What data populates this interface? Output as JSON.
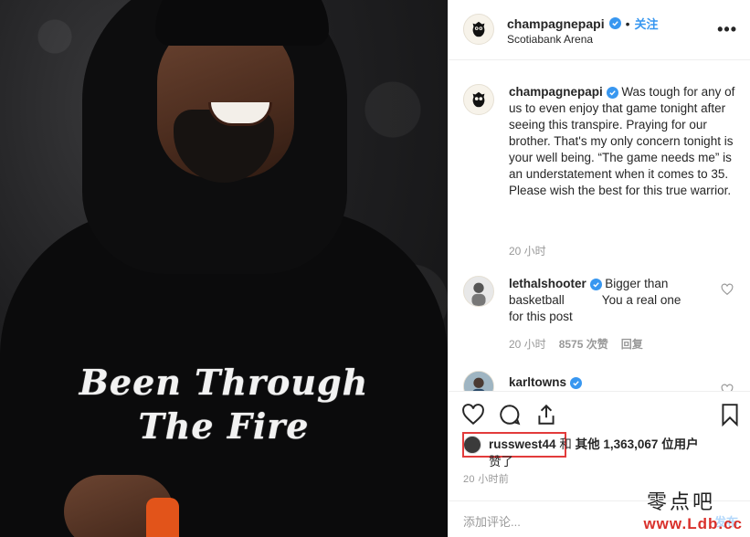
{
  "post": {
    "username": "champagnepapi",
    "follow_label": "关注",
    "follow_separator": "•",
    "location": "Scotiabank Arena",
    "more_label": "•••",
    "hoodie_line1": "Been Through",
    "hoodie_line2": "The Fire"
  },
  "caption": {
    "username": "champagnepapi",
    "text": "Was tough for any of us to even enjoy that game tonight after seeing this transpire. Praying for our brother. That's my only concern tonight is your well being. “The game needs me” is an understatement when it comes to 35. Please wish the best for this true warrior.",
    "time": "20 小时"
  },
  "comments": [
    {
      "username": "lethalshooter",
      "text": "Bigger than basketball           You a real one for this post",
      "time": "20 小时",
      "likes": "8575 次赞",
      "reply_label": "回复"
    },
    {
      "username": "karltowns",
      "text": ""
    }
  ],
  "likes": {
    "user": "russwest44",
    "connector": "和",
    "others_prefix": "其他",
    "count": "1,363,067",
    "others_suffix": "位用户",
    "line2": "赞了"
  },
  "timestamp": "20 小时前",
  "add_comment": {
    "placeholder": "添加评论...",
    "publish_label": "发布"
  },
  "watermark": {
    "line1": "零点吧",
    "line2": "www.Ldb.cc"
  },
  "colors": {
    "link_blue": "#3897f0",
    "verified_blue": "#3897f0",
    "highlight_red": "#e23b3b",
    "muted": "#999999"
  },
  "icons": [
    "verified-icon",
    "heart-icon",
    "comment-icon",
    "share-icon",
    "bookmark-icon",
    "more-icon"
  ]
}
